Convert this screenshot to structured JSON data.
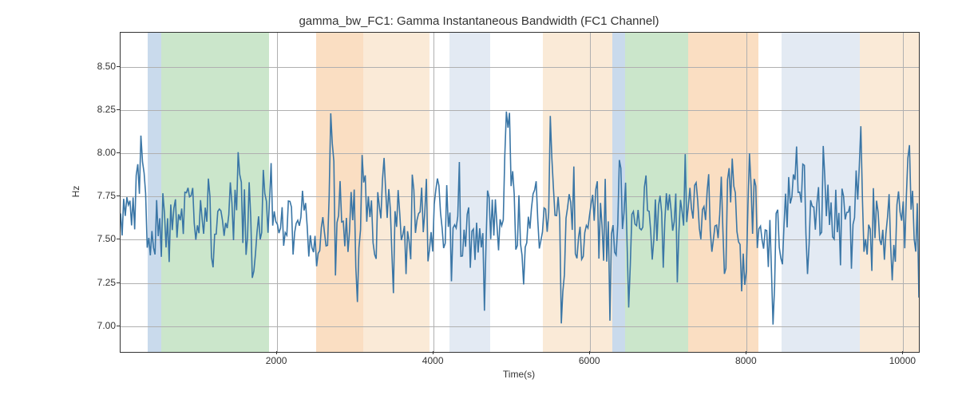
{
  "chart_data": {
    "type": "line",
    "title": "gamma_bw_FC1: Gamma Instantaneous Bandwidth (FC1 Channel)",
    "xlabel": "Time(s)",
    "ylabel": "Hz",
    "xlim": [
      0,
      10200
    ],
    "ylim": [
      6.85,
      8.7
    ],
    "x_ticks": [
      2000,
      4000,
      6000,
      8000,
      10000
    ],
    "y_ticks": [
      7.0,
      7.25,
      7.5,
      7.75,
      8.0,
      8.25,
      8.5
    ],
    "bands": [
      {
        "start": 350,
        "end": 520,
        "color": "blue"
      },
      {
        "start": 520,
        "end": 1900,
        "color": "green"
      },
      {
        "start": 2500,
        "end": 3100,
        "color": "orange"
      },
      {
        "start": 3100,
        "end": 3950,
        "color": "orange-light"
      },
      {
        "start": 4200,
        "end": 4720,
        "color": "blue-light"
      },
      {
        "start": 5400,
        "end": 6280,
        "color": "orange-light"
      },
      {
        "start": 6280,
        "end": 6450,
        "color": "blue"
      },
      {
        "start": 6450,
        "end": 7250,
        "color": "green"
      },
      {
        "start": 7250,
        "end": 8150,
        "color": "orange"
      },
      {
        "start": 8450,
        "end": 9450,
        "color": "blue-light"
      },
      {
        "start": 9450,
        "end": 10200,
        "color": "orange-light"
      }
    ],
    "series": {
      "name": "gamma_bw_FC1",
      "color": "#3a76a6",
      "mean": 7.62,
      "std": 0.18,
      "n_points": 510
    }
  }
}
